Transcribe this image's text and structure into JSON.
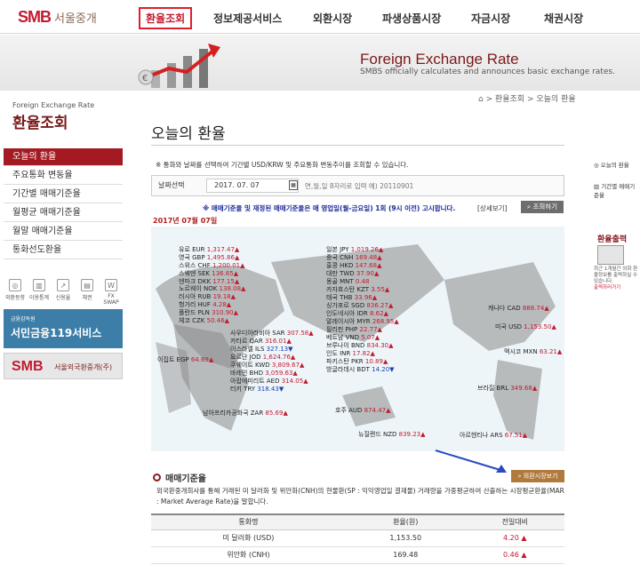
{
  "header": {
    "logo_mark": "SMB",
    "logo_text": "서울중개",
    "nav": [
      "환율조회",
      "정보제공서비스",
      "외환시장",
      "파생상품시장",
      "자금시장",
      "채권시장"
    ]
  },
  "banner": {
    "title": "Foreign Exchange Rate",
    "subtitle": "SMBS officially calculates and announces basic exchange rates."
  },
  "sidebar": {
    "small_title": "Foreign Exchange Rate",
    "title": "환율조회",
    "items": [
      "오늘의 환율",
      "주요통화 변동율",
      "기간별 매매기준율",
      "월평균 매매기준율",
      "월말 매매기준율",
      "통화선도환율"
    ],
    "quick_icons": [
      "외환동향",
      "이용통계",
      "신용율",
      "채권",
      "FX SWAP"
    ],
    "ad1_small": "금융감독원",
    "ad1_text": "서민금융119서비스",
    "ad2_mark": "SMB",
    "ad2_text": "서울외국환중개(주)"
  },
  "breadcrumb": [
    "환율조회",
    "오늘의 환율"
  ],
  "page_title": "오늘의 환율",
  "note": "※ 통화와 날짜를 선택하여 기간별 USD/KRW 및 주요통화 변동추이를 조회할 수 있습니다.",
  "date_label": "날짜선택",
  "date_value": "2017. 07. 07",
  "date_hint": "연,월,일 8자리로 입력 예) 20110901",
  "notice": "※ 매매기준율 및 재정된 매매기준율은 매 영업일(월-금요일) 1회 (9시 이전) 고시합니다.",
  "notice_link": "[상세보기]",
  "print_button": "조회하기",
  "shown_date": "2017년 07월 07일",
  "rates": [
    {
      "name": "유로 EUR",
      "value": "1,317.47",
      "dir": "up"
    },
    {
      "name": "영국 GBP",
      "value": "1,495.86",
      "dir": "up"
    },
    {
      "name": "스위스 CHF",
      "value": "1,200.01",
      "dir": "up"
    },
    {
      "name": "스웨덴 SEK",
      "value": "136.65",
      "dir": "up"
    },
    {
      "name": "덴마크 DKK",
      "value": "177.15",
      "dir": "up"
    },
    {
      "name": "노르웨이 NOK",
      "value": "138.08",
      "dir": "up"
    },
    {
      "name": "러시아 RUB",
      "value": "19.18",
      "dir": "up"
    },
    {
      "name": "헝가리 HUF",
      "value": "4.28",
      "dir": "up"
    },
    {
      "name": "폴란드 PLN",
      "value": "310.90",
      "dir": "up"
    },
    {
      "name": "체코 CZK",
      "value": "50.46",
      "dir": "up"
    },
    {
      "name": "사우디아라비아 SAR",
      "value": "307.58",
      "dir": "up"
    },
    {
      "name": "카타르 QAR",
      "value": "316.01",
      "dir": "up"
    },
    {
      "name": "이스라엘 ILS",
      "value": "327.13",
      "dir": "dn"
    },
    {
      "name": "요르단 JOD",
      "value": "1,624.76",
      "dir": "up"
    },
    {
      "name": "쿠웨이트 KWD",
      "value": "3,809.67",
      "dir": "up"
    },
    {
      "name": "바레인 BHD",
      "value": "3,059.63",
      "dir": "up"
    },
    {
      "name": "아랍에미리트 AED",
      "value": "314.05",
      "dir": "up"
    },
    {
      "name": "터키 TRY",
      "value": "318.43",
      "dir": "dn"
    },
    {
      "name": "이집트 EGP",
      "value": "64.69",
      "dir": "up"
    },
    {
      "name": "남아프리카공화국 ZAR",
      "value": "85.69",
      "dir": "up"
    },
    {
      "name": "일본 JPY",
      "value": "1,019.26",
      "dir": "up"
    },
    {
      "name": "중국 CNH",
      "value": "169.48",
      "dir": "up"
    },
    {
      "name": "홍콩 HKD",
      "value": "147.68",
      "dir": "up"
    },
    {
      "name": "대만 TWD",
      "value": "37.90",
      "dir": "up"
    },
    {
      "name": "몽골 MNT",
      "value": "0.48",
      "dir": "none"
    },
    {
      "name": "카자흐스탄 KZT",
      "value": "3.55",
      "dir": "up"
    },
    {
      "name": "태국 THB",
      "value": "33.96",
      "dir": "up"
    },
    {
      "name": "싱가포르 SGD",
      "value": "836.27",
      "dir": "up"
    },
    {
      "name": "인도네시아 IDR",
      "value": "8.62",
      "dir": "up"
    },
    {
      "name": "말레이시아 MYR",
      "value": "268.95",
      "dir": "up"
    },
    {
      "name": "필리핀 PHP",
      "value": "22.77",
      "dir": "up"
    },
    {
      "name": "베트남 VND",
      "value": "5.07",
      "dir": "up"
    },
    {
      "name": "브루나이 BND",
      "value": "834.30",
      "dir": "up"
    },
    {
      "name": "인도 INR",
      "value": "17.82",
      "dir": "up"
    },
    {
      "name": "파키스탄 PKR",
      "value": "10.89",
      "dir": "up"
    },
    {
      "name": "방글라데시 BDT",
      "value": "14.20",
      "dir": "dn"
    },
    {
      "name": "호주 AUD",
      "value": "874.47",
      "dir": "up"
    },
    {
      "name": "뉴질랜드 NZD",
      "value": "839.23",
      "dir": "up"
    },
    {
      "name": "캐나다 CAD",
      "value": "888.74",
      "dir": "up"
    },
    {
      "name": "미국 USD",
      "value": "1,153.50",
      "dir": "up"
    },
    {
      "name": "멕시코 MXN",
      "value": "63.21",
      "dir": "up"
    },
    {
      "name": "브라질 BRL",
      "value": "349.68",
      "dir": "up"
    },
    {
      "name": "아르헨티나 ARS",
      "value": "67.51",
      "dir": "up"
    }
  ],
  "section2": {
    "title": "매매기준율",
    "button": "외환시장보기",
    "desc": "외국환중개회사를 통해 거래된 미 달러화 및 위안화(CNH)의 현물환(SP : 익익영업일 결제물) 거래량을 가중평균하여 산출하는 시장평균환율(MAR : Market Average Rate)을 말합니다.",
    "columns": [
      "통화명",
      "환율(원)",
      "전일대비"
    ],
    "rows": [
      {
        "name": "미 달러화 (USD)",
        "rate": "1,153.50",
        "change": "4.20 ▲"
      },
      {
        "name": "위안화 (CNH)",
        "rate": "169.48",
        "change": "0.46 ▲"
      }
    ]
  },
  "right_side": {
    "items": [
      "오늘의 환율",
      "기간별 매매기준율"
    ],
    "title": "환율출력",
    "desc": "최근 1개월간 외화 환율정보를 출력하실 수 있습니다.",
    "link": "출력하러가기"
  }
}
